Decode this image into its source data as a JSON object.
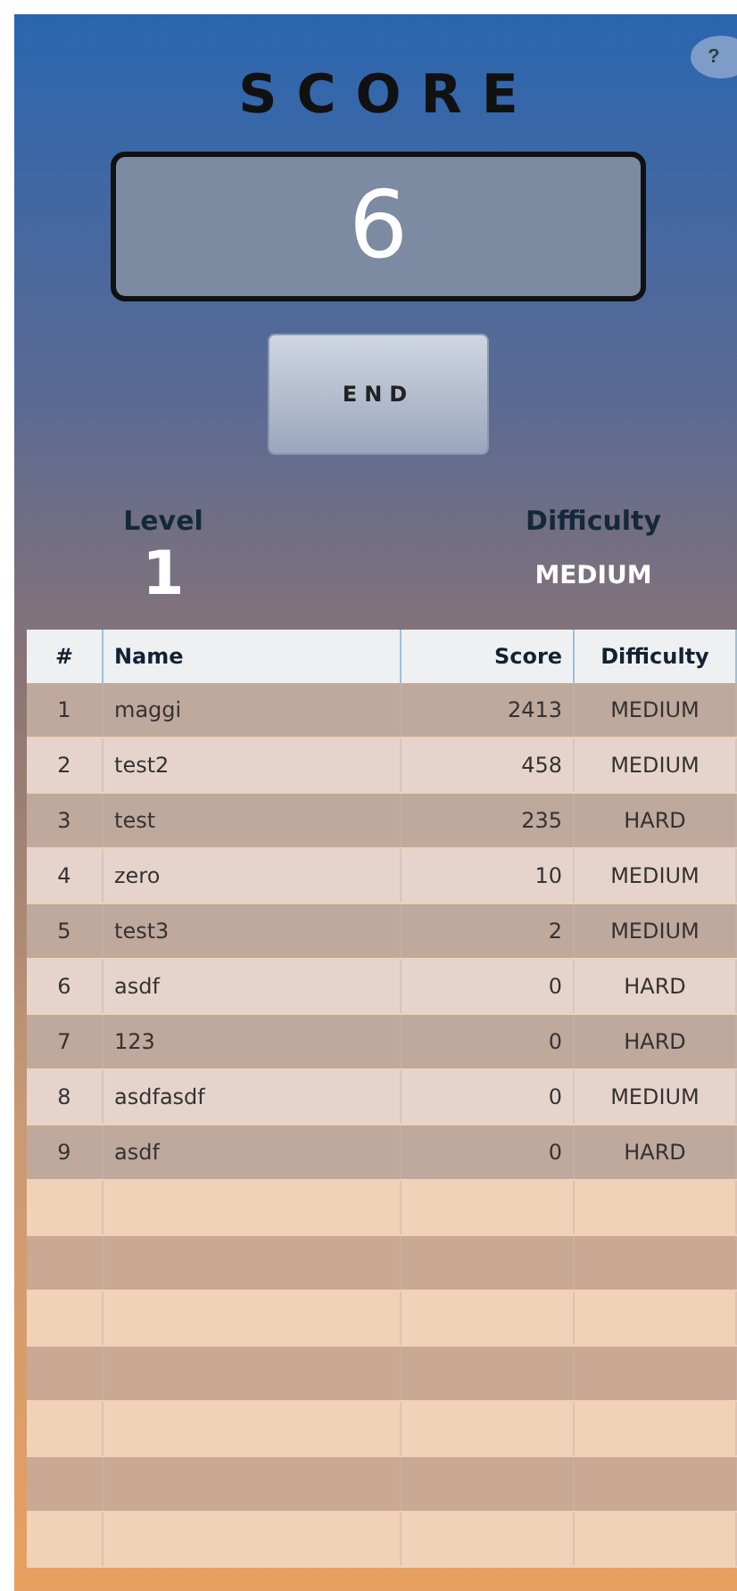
{
  "help_button": "?",
  "title": "SCORE",
  "score": "6",
  "end_button": "END",
  "level": {
    "label": "Level",
    "value": "1"
  },
  "difficulty": {
    "label": "Difficulty",
    "value": "MEDIUM"
  },
  "table": {
    "columns": [
      "#",
      "Name",
      "Score",
      "Difficulty"
    ],
    "rows": [
      {
        "rank": "1",
        "name": "maggi",
        "score": "2413",
        "difficulty": "MEDIUM"
      },
      {
        "rank": "2",
        "name": "test2",
        "score": "458",
        "difficulty": "MEDIUM"
      },
      {
        "rank": "3",
        "name": "test",
        "score": "235",
        "difficulty": "HARD"
      },
      {
        "rank": "4",
        "name": "zero",
        "score": "10",
        "difficulty": "MEDIUM"
      },
      {
        "rank": "5",
        "name": "test3",
        "score": "2",
        "difficulty": "MEDIUM"
      },
      {
        "rank": "6",
        "name": "asdf",
        "score": "0",
        "difficulty": "HARD"
      },
      {
        "rank": "7",
        "name": "123",
        "score": "0",
        "difficulty": "HARD"
      },
      {
        "rank": "8",
        "name": "asdfasdf",
        "score": "0",
        "difficulty": "MEDIUM"
      },
      {
        "rank": "9",
        "name": "asdf",
        "score": "0",
        "difficulty": "HARD"
      }
    ]
  }
}
